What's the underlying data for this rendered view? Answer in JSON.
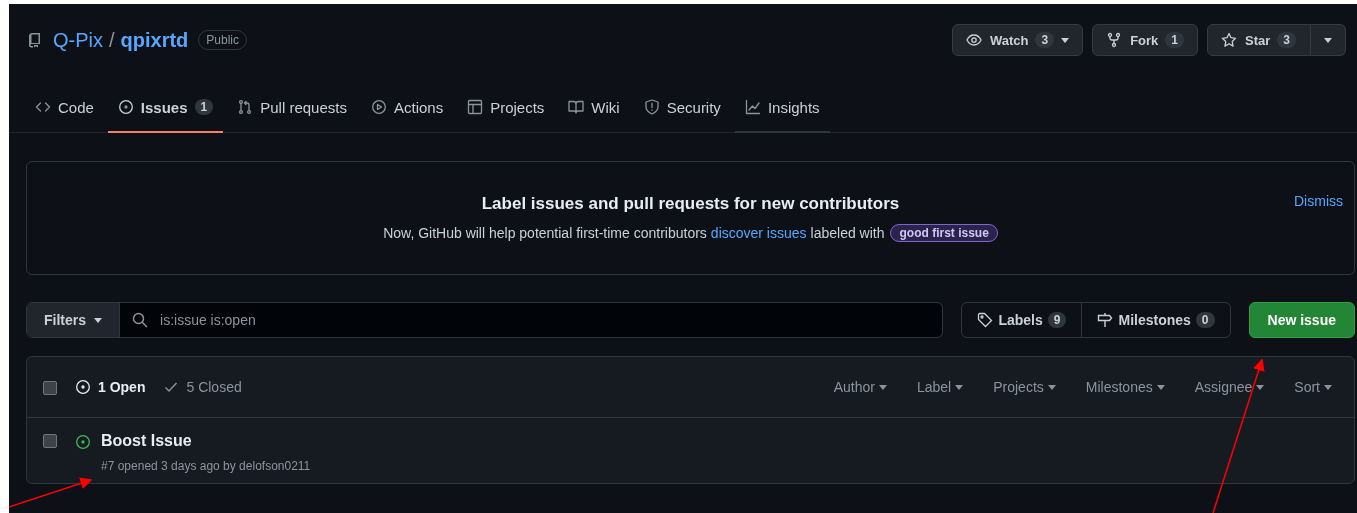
{
  "repo": {
    "owner": "Q-Pix",
    "separator": "/",
    "name": "qpixrtd",
    "visibility": "Public"
  },
  "repo_actions": [
    {
      "label": "Watch",
      "count": "3",
      "dropdown": true
    },
    {
      "label": "Fork",
      "count": "1",
      "dropdown": false
    },
    {
      "label": "Star",
      "count": "3",
      "dropdown": true
    }
  ],
  "tabs": [
    {
      "label": "Code",
      "selected": false,
      "hovered": false
    },
    {
      "label": "Issues",
      "count": "1",
      "selected": true,
      "hovered": false
    },
    {
      "label": "Pull requests",
      "selected": false,
      "hovered": false
    },
    {
      "label": "Actions",
      "selected": false,
      "hovered": false
    },
    {
      "label": "Projects",
      "selected": false,
      "hovered": false
    },
    {
      "label": "Wiki",
      "selected": false,
      "hovered": false
    },
    {
      "label": "Security",
      "selected": false,
      "hovered": false
    },
    {
      "label": "Insights",
      "selected": false,
      "hovered": true
    }
  ],
  "banner": {
    "title": "Label issues and pull requests for new contributors",
    "text_before": "Now, GitHub will help potential first-time contributors",
    "link": "discover issues",
    "text_after": "labeled with",
    "label": "good first issue",
    "dismiss": "Dismiss"
  },
  "filters": {
    "button": "Filters",
    "search_value": "is:issue is:open",
    "labels": {
      "label": "Labels",
      "count": "9"
    },
    "milestones": {
      "label": "Milestones",
      "count": "0"
    },
    "new_issue": "New issue"
  },
  "list_header": {
    "checked": false,
    "open": "1 Open",
    "closed": "5 Closed",
    "open_selected": true,
    "menus": [
      "Author",
      "Label",
      "Projects",
      "Milestones",
      "Assignee",
      "Sort"
    ]
  },
  "issues": [
    {
      "checked": false,
      "title": "Boost Issue",
      "meta": "#7 opened 3 days ago by delofson0211"
    }
  ]
}
